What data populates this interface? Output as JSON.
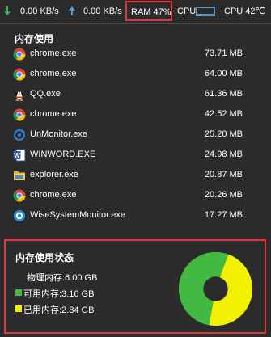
{
  "topbar": {
    "download_speed": "0.00 KB/s",
    "upload_speed": "0.00 KB/s",
    "ram": "RAM 47%",
    "cpu_label": "CPU",
    "cpu_temp": "CPU 42℃"
  },
  "memory_usage": {
    "title": "内存使用",
    "processes": [
      {
        "name": "chrome.exe",
        "memory": "73.71 MB",
        "icon": "chrome-icon"
      },
      {
        "name": "chrome.exe",
        "memory": "64.00 MB",
        "icon": "chrome-icon"
      },
      {
        "name": "QQ.exe",
        "memory": "61.36 MB",
        "icon": "qq-penguin-icon"
      },
      {
        "name": "chrome.exe",
        "memory": "42.52 MB",
        "icon": "chrome-icon"
      },
      {
        "name": "UnMonitor.exe",
        "memory": "25.20 MB",
        "icon": "refresh-circle-icon"
      },
      {
        "name": "WINWORD.EXE",
        "memory": "24.98 MB",
        "icon": "word-icon"
      },
      {
        "name": "explorer.exe",
        "memory": "20.87 MB",
        "icon": "folder-icon"
      },
      {
        "name": "chrome.exe",
        "memory": "20.26 MB",
        "icon": "chrome-icon"
      },
      {
        "name": "WiseSystemMonitor.exe",
        "memory": "17.27 MB",
        "icon": "wise-monitor-icon"
      }
    ]
  },
  "memory_status": {
    "title": "内存使用状态",
    "physical": "物理内存:6.00 GB",
    "available": "可用内存:3.16 GB",
    "used": "已用内存:2.84 GB",
    "available_fraction": 0.527,
    "used_fraction": 0.473,
    "available_color": "#43b943",
    "used_color": "#f0f000"
  },
  "colors": {
    "background": "#2b2b2b",
    "highlight_border": "#e3363b",
    "arrow_down": "#3cb44b",
    "arrow_up": "#4e9ad8"
  }
}
